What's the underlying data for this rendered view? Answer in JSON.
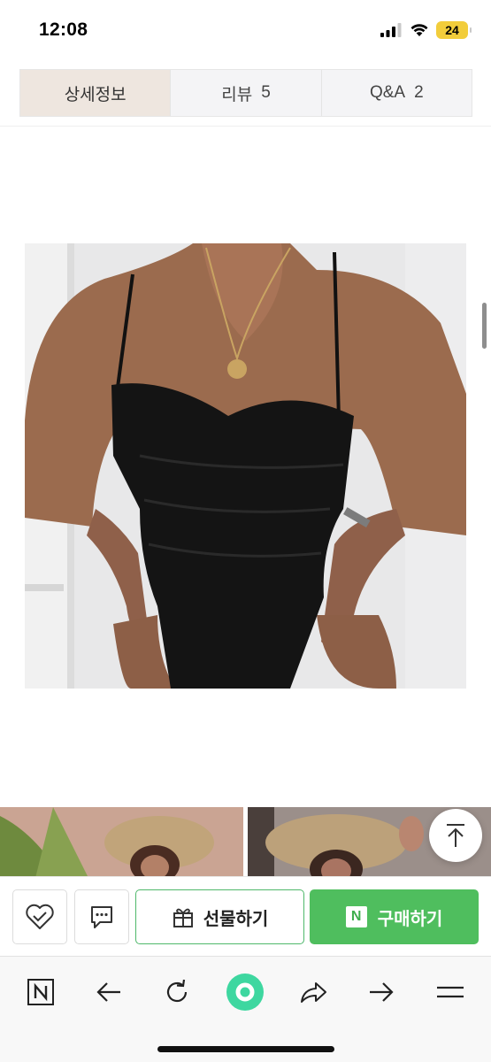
{
  "status_bar": {
    "time": "12:08",
    "battery": "24",
    "battery_color": "#f2cd3b"
  },
  "tabs": [
    {
      "label": "상세정보",
      "count": "",
      "active": true
    },
    {
      "label": "리뷰",
      "count": "5",
      "active": false
    },
    {
      "label": "Q&A",
      "count": "2",
      "active": false
    }
  ],
  "product": {
    "image": "black-bodysuit-photo",
    "thumbnails": [
      "straw-hat-photo-1",
      "straw-hat-photo-2"
    ]
  },
  "scroll_top_icon": "arrow-up-to-top-icon",
  "purchase_bar": {
    "wishlist_icon": "heart-check-icon",
    "chat_icon": "chat-bubble-icon",
    "gift_label": "선물하기",
    "gift_icon": "gift-box-icon",
    "buy_label": "구매하기",
    "buy_badge": "N",
    "buy_color": "#4fbe5e"
  },
  "toolbar": {
    "items": [
      "naver-home-icon",
      "back-arrow-icon",
      "refresh-icon",
      "green-dot-icon",
      "share-icon",
      "forward-arrow-icon",
      "menu-icon"
    ]
  }
}
